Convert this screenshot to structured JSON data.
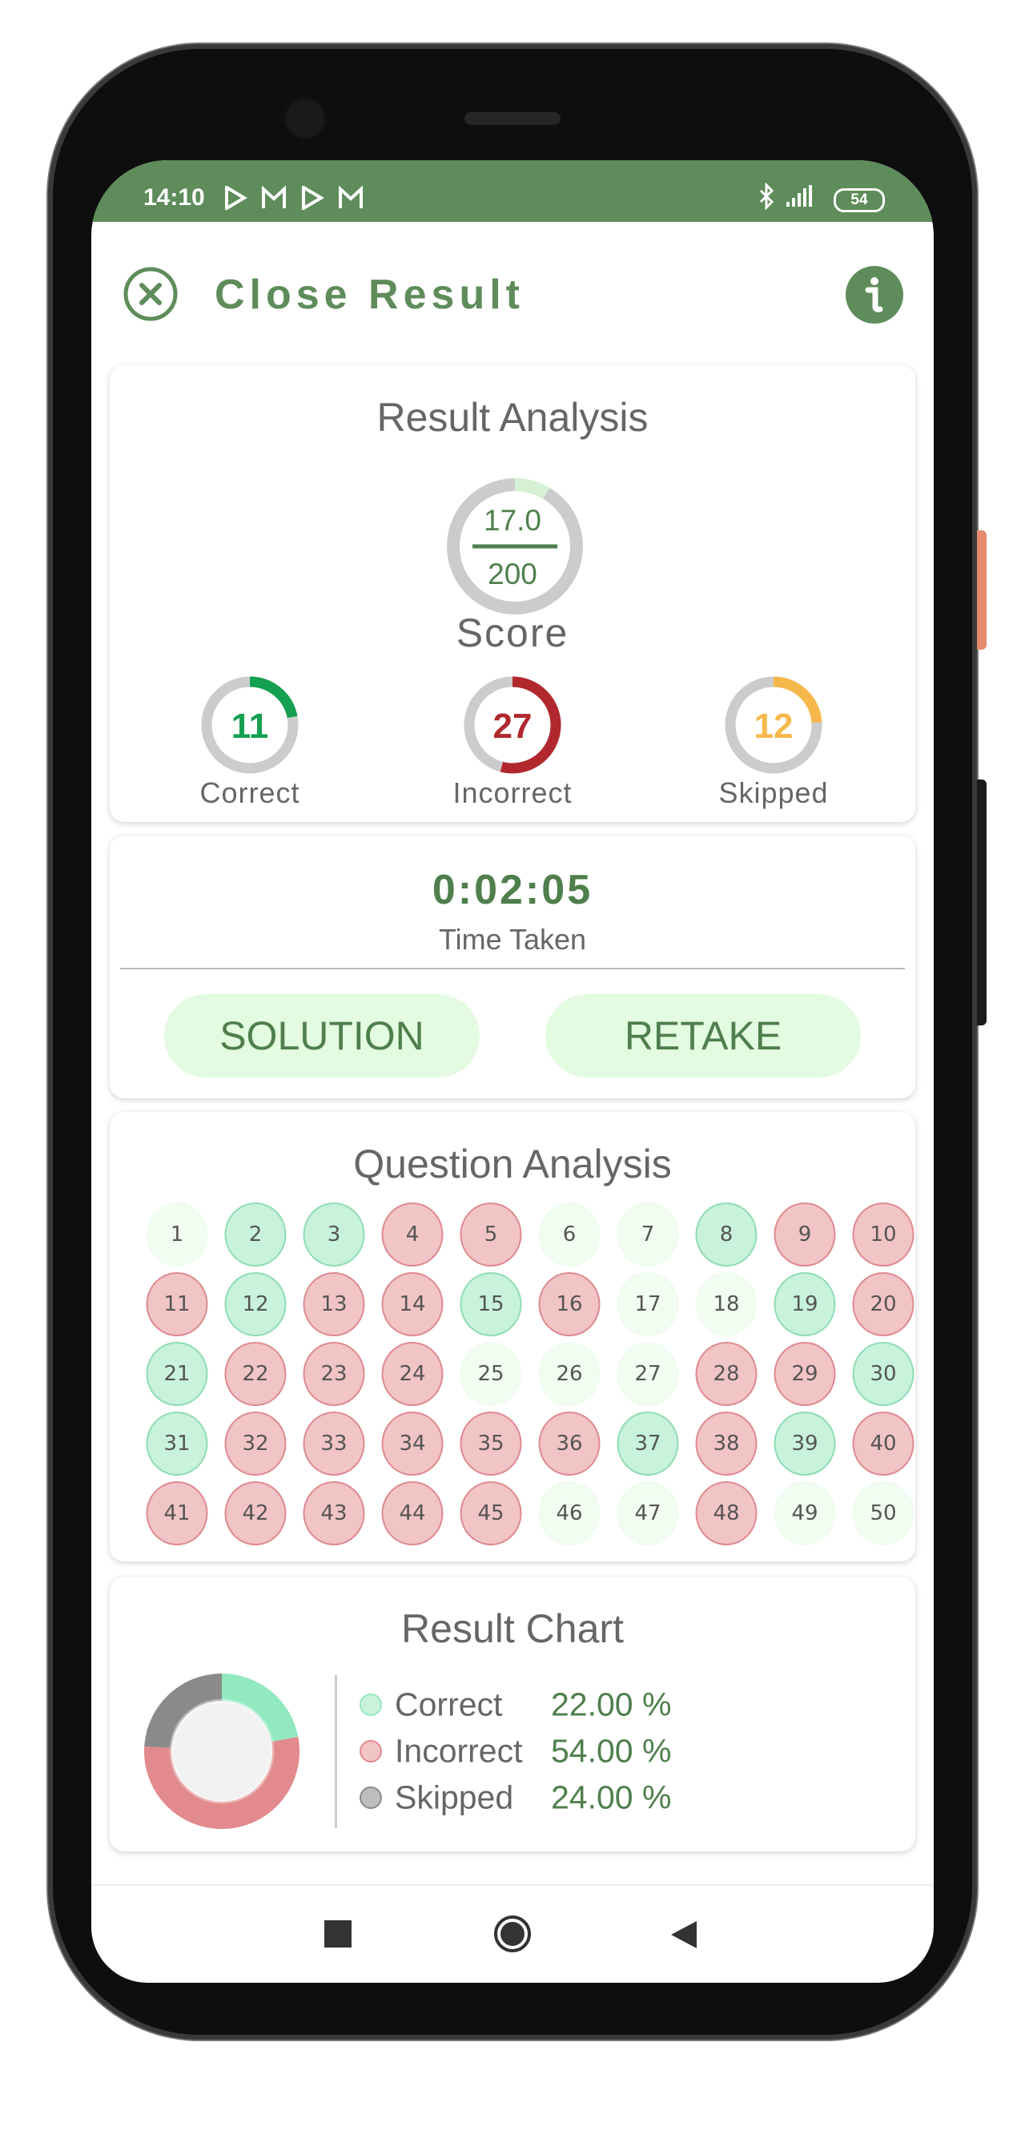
{
  "status_bar": {
    "time": "14:10",
    "battery": "54",
    "icons": [
      "play-store-icon",
      "gmail-icon",
      "play-store-icon",
      "gmail-icon",
      "bluetooth-icon",
      "signal-icon",
      "battery-icon"
    ]
  },
  "header": {
    "title": "Close Result",
    "close_icon": "close-circle-icon",
    "info_icon": "info-icon"
  },
  "colors": {
    "brand": "#5e8c5a",
    "correct": "#14a050",
    "incorrect": "#b0282e",
    "skipped": "#f7b84b",
    "button_bg": "#e3fbe0"
  },
  "result_analysis": {
    "title": "Result Analysis",
    "score": {
      "value": "17.0",
      "total": "200",
      "label": "Score",
      "fraction": 0.085
    },
    "stats": [
      {
        "label": "Correct",
        "value": "11",
        "fraction": 0.22,
        "color": "#14a050"
      },
      {
        "label": "Incorrect",
        "value": "27",
        "fraction": 0.54,
        "color": "#b0282e"
      },
      {
        "label": "Skipped",
        "value": "12",
        "fraction": 0.24,
        "color": "#f7b84b"
      }
    ]
  },
  "time": {
    "value": "0:02:05",
    "label": "Time Taken",
    "solution_label": "SOLUTION",
    "retake_label": "RETAKE"
  },
  "question_analysis": {
    "title": "Question Analysis",
    "questions": [
      {
        "n": "1",
        "s": "skipped"
      },
      {
        "n": "2",
        "s": "correct"
      },
      {
        "n": "3",
        "s": "correct"
      },
      {
        "n": "4",
        "s": "incorrect"
      },
      {
        "n": "5",
        "s": "incorrect"
      },
      {
        "n": "6",
        "s": "skipped"
      },
      {
        "n": "7",
        "s": "skipped"
      },
      {
        "n": "8",
        "s": "correct"
      },
      {
        "n": "9",
        "s": "incorrect"
      },
      {
        "n": "10",
        "s": "incorrect"
      },
      {
        "n": "11",
        "s": "incorrect"
      },
      {
        "n": "12",
        "s": "correct"
      },
      {
        "n": "13",
        "s": "incorrect"
      },
      {
        "n": "14",
        "s": "incorrect"
      },
      {
        "n": "15",
        "s": "correct"
      },
      {
        "n": "16",
        "s": "incorrect"
      },
      {
        "n": "17",
        "s": "skipped"
      },
      {
        "n": "18",
        "s": "skipped"
      },
      {
        "n": "19",
        "s": "correct"
      },
      {
        "n": "20",
        "s": "incorrect"
      },
      {
        "n": "21",
        "s": "correct"
      },
      {
        "n": "22",
        "s": "incorrect"
      },
      {
        "n": "23",
        "s": "incorrect"
      },
      {
        "n": "24",
        "s": "incorrect"
      },
      {
        "n": "25",
        "s": "skipped"
      },
      {
        "n": "26",
        "s": "skipped"
      },
      {
        "n": "27",
        "s": "skipped"
      },
      {
        "n": "28",
        "s": "incorrect"
      },
      {
        "n": "29",
        "s": "incorrect"
      },
      {
        "n": "30",
        "s": "correct"
      },
      {
        "n": "31",
        "s": "correct"
      },
      {
        "n": "32",
        "s": "incorrect"
      },
      {
        "n": "33",
        "s": "incorrect"
      },
      {
        "n": "34",
        "s": "incorrect"
      },
      {
        "n": "35",
        "s": "incorrect"
      },
      {
        "n": "36",
        "s": "incorrect"
      },
      {
        "n": "37",
        "s": "correct"
      },
      {
        "n": "38",
        "s": "incorrect"
      },
      {
        "n": "39",
        "s": "correct"
      },
      {
        "n": "40",
        "s": "incorrect"
      },
      {
        "n": "41",
        "s": "incorrect"
      },
      {
        "n": "42",
        "s": "incorrect"
      },
      {
        "n": "43",
        "s": "incorrect"
      },
      {
        "n": "44",
        "s": "incorrect"
      },
      {
        "n": "45",
        "s": "incorrect"
      },
      {
        "n": "46",
        "s": "skipped"
      },
      {
        "n": "47",
        "s": "skipped"
      },
      {
        "n": "48",
        "s": "incorrect"
      },
      {
        "n": "49",
        "s": "skipped"
      },
      {
        "n": "50",
        "s": "skipped"
      }
    ]
  },
  "chart_data": {
    "type": "pie",
    "title": "Result Chart",
    "categories": [
      "Correct",
      "Incorrect",
      "Skipped"
    ],
    "values": [
      22.0,
      54.0,
      24.0
    ],
    "labels": [
      "22.00 %",
      "54.00 %",
      "24.00 %"
    ],
    "colors": [
      "#93e9bf",
      "#e28a8d",
      "#8a8a8a"
    ],
    "legend_dot_colors": [
      "#c8f2dc",
      "#f1c4c6",
      "#bdbdbd"
    ],
    "donut": true,
    "legend_placement": "right"
  },
  "nav": {
    "icons": [
      "recent-apps-icon",
      "home-icon",
      "back-icon"
    ]
  }
}
